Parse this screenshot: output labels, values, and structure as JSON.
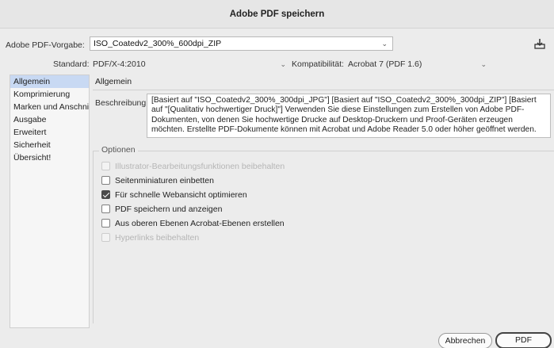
{
  "window": {
    "title": "Adobe PDF speichern"
  },
  "preset": {
    "label": "Adobe PDF-Vorgabe:",
    "value": "ISO_Coatedv2_300%_600dpi_ZIP"
  },
  "standard": {
    "label": "Standard:",
    "value": "PDF/X-4:2010"
  },
  "compat": {
    "label": "Kompatibilität:",
    "value": "Acrobat 7 (PDF 1.6)"
  },
  "icons": {
    "save_preset": "save-preset-icon",
    "chevron": "chevron-down-icon"
  },
  "sidebar": {
    "items": [
      {
        "label": "Allgemein",
        "selected": true
      },
      {
        "label": "Komprimierung"
      },
      {
        "label": "Marken und Anschnitt"
      },
      {
        "label": "Ausgabe"
      },
      {
        "label": "Erweitert"
      },
      {
        "label": "Sicherheit"
      },
      {
        "label": "Übersicht!"
      }
    ]
  },
  "section": {
    "title": "Allgemein"
  },
  "description": {
    "label": "Beschreibung:",
    "text": "[Basiert auf \"ISO_Coatedv2_300%_300dpi_JPG\"] [Basiert auf \"ISO_Coatedv2_300%_300dpi_ZIP\"] [Basiert auf \"[Qualitativ hochwertiger Druck]\"] Verwenden Sie diese Einstellungen zum Erstellen von Adobe PDF-Dokumenten, von denen Sie hochwertige Drucke auf Desktop-Druckern und Proof-Geräten erzeugen möchten. Erstellte PDF-Dokumente können mit Acrobat und Adobe Reader 5.0 oder höher geöffnet werden."
  },
  "options": {
    "title": "Optionen",
    "items": [
      {
        "label": "Illustrator-Bearbeitungsfunktionen beibehalten",
        "checked": false,
        "disabled": true
      },
      {
        "label": "Seitenminiaturen einbetten",
        "checked": false,
        "disabled": false
      },
      {
        "label": "Für schnelle Webansicht optimieren",
        "checked": true,
        "disabled": false
      },
      {
        "label": "PDF speichern und anzeigen",
        "checked": false,
        "disabled": false
      },
      {
        "label": "Aus oberen Ebenen Acrobat-Ebenen erstellen",
        "checked": false,
        "disabled": false
      },
      {
        "label": "Hyperlinks beibehalten",
        "checked": false,
        "disabled": true
      }
    ]
  },
  "buttons": {
    "cancel": "Abbrechen",
    "save": "PDF speichern"
  }
}
